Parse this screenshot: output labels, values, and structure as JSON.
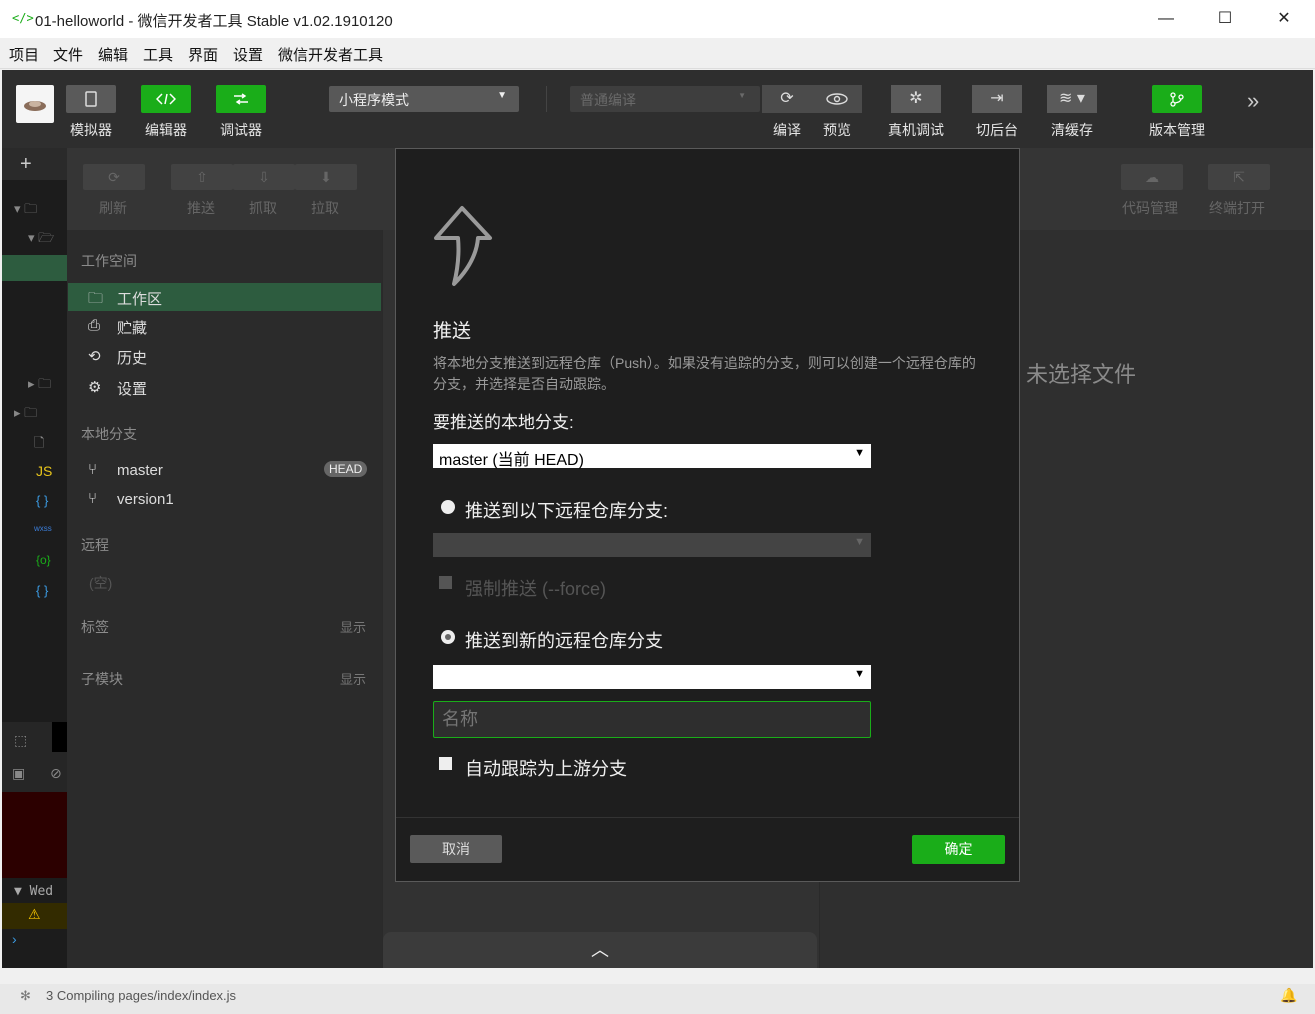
{
  "window": {
    "logo": "</>",
    "title": "01-helloworld - 微信开发者工具 Stable v1.02.1910120",
    "minimize": "—",
    "maximize": "☐",
    "close": "✕"
  },
  "menu": [
    "项目",
    "文件",
    "编辑",
    "工具",
    "界面",
    "设置",
    "微信开发者工具"
  ],
  "toolbar": {
    "simulator": "模拟器",
    "editor": "编辑器",
    "debugger": "调试器",
    "mode_select": "小程序模式",
    "compile_select": "普通编译",
    "compile": "编译",
    "preview": "预览",
    "real_debug": "真机调试",
    "background": "切后台",
    "clear_cache": "清缓存",
    "version": "版本管理",
    "more": "»"
  },
  "git_toolbar": {
    "refresh": "刷新",
    "push": "推送",
    "fetch": "抓取",
    "pull": "拉取",
    "code_mgmt": "代码管理",
    "terminal": "终端打开"
  },
  "left_panel": {
    "workspace_header": "工作空间",
    "workspace_items": [
      "工作区",
      "贮藏",
      "历史",
      "设置"
    ],
    "local_branch_header": "本地分支",
    "branches": [
      "master",
      "version1"
    ],
    "head_badge": "HEAD",
    "remote_header": "远程",
    "remote_empty": "(空)",
    "tags_header": "标签",
    "tags_show": "显示",
    "submodule_header": "子模块",
    "submodule_show": "显示"
  },
  "right_panel": {
    "no_file": "未选择文件"
  },
  "left_dim": {
    "console_day": "Wed"
  },
  "status_bar": {
    "text": "3 Compiling pages/index/index.js"
  },
  "modal": {
    "title": "推送",
    "description": "将本地分支推送到远程仓库（Push）。如果没有追踪的分支，则可以创建一个远程仓库的分支，并选择是否自动跟踪。",
    "local_branch_label": "要推送的本地分支:",
    "local_branch_value": "master (当前 HEAD)",
    "option_existing": "推送到以下远程仓库分支:",
    "force_push": "强制推送 (--force)",
    "option_new": "推送到新的远程仓库分支",
    "name_placeholder": "名称",
    "auto_track": "自动跟踪为上游分支",
    "cancel": "取消",
    "confirm": "确定"
  },
  "colors": {
    "accent": "#1aad19",
    "dark_bg": "#1e1e1e"
  }
}
